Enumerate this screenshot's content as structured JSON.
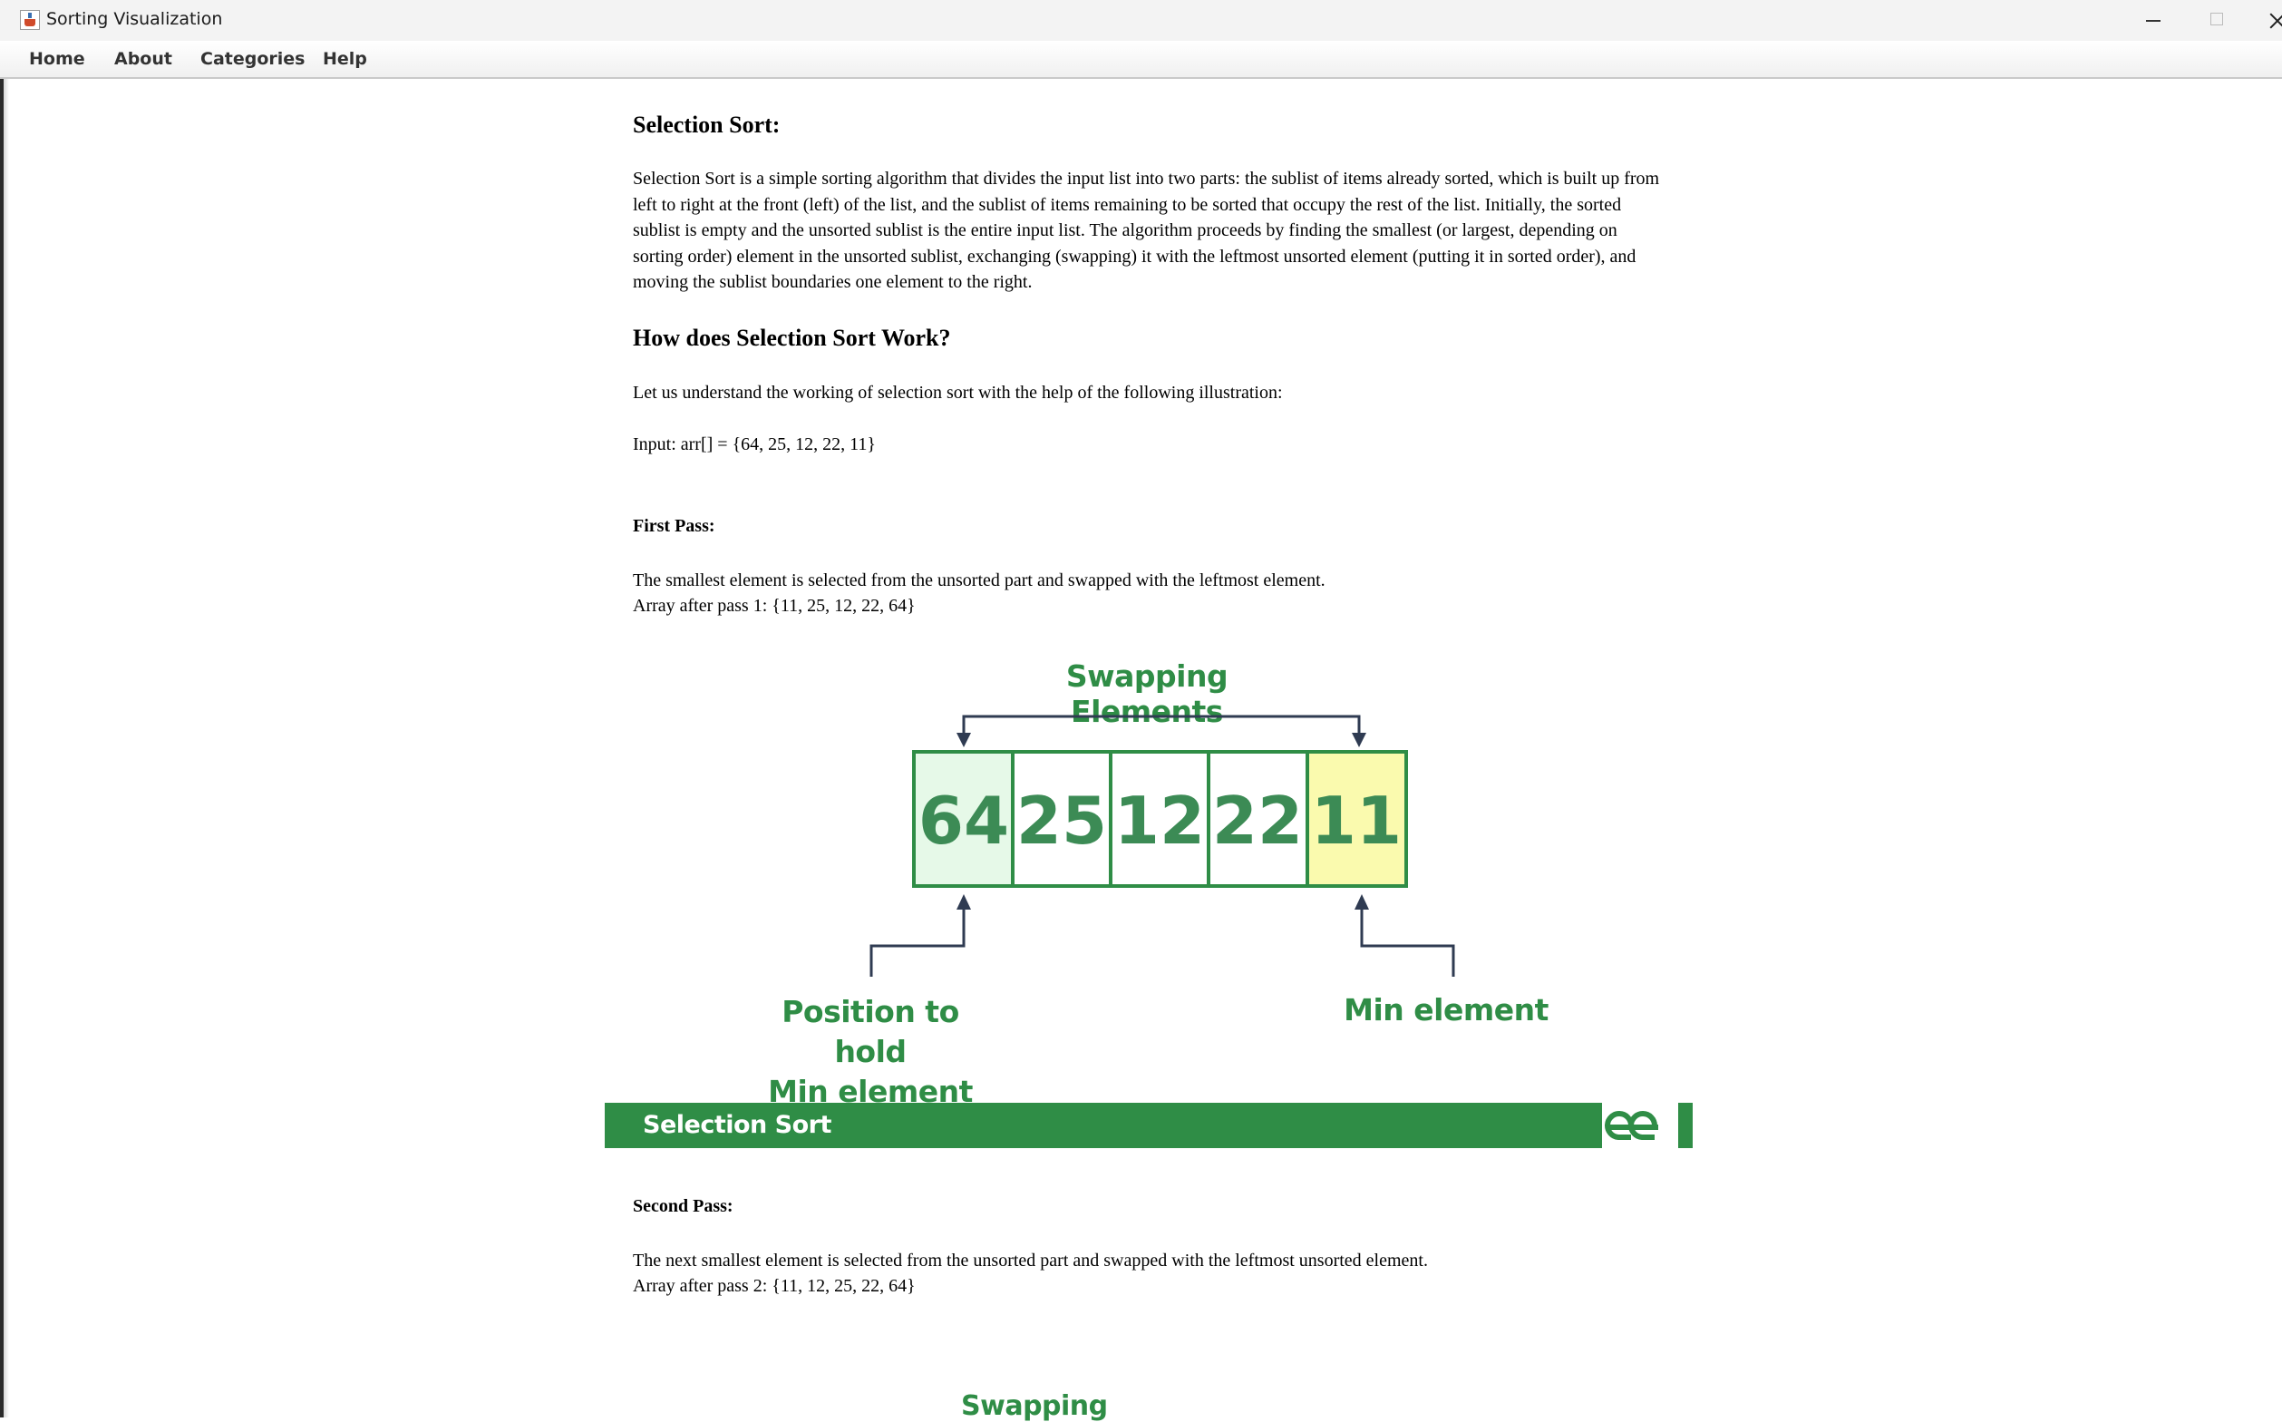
{
  "window": {
    "title": "Sorting Visualization"
  },
  "menu": [
    {
      "label": "Home"
    },
    {
      "label": "About"
    },
    {
      "label": "Categories"
    },
    {
      "label": "Help"
    }
  ],
  "article": {
    "heading": "Selection Sort:",
    "intro": "Selection Sort is a simple sorting algorithm that divides the input list into two parts: the sublist of items already sorted, which is built up from left to right at the front (left) of the list, and the sublist of items remaining to be sorted that occupy the rest of the list. Initially, the sorted sublist is empty and the unsorted sublist is the entire input list. The algorithm proceeds by finding the smallest (or largest, depending on sorting order) element in the unsorted sublist, exchanging (swapping) it with the leftmost unsorted element (putting it in sorted order), and moving the sublist boundaries one element to the right.",
    "how_heading": "How does Selection Sort Work?",
    "how_intro": "Let us understand the working of selection sort with the help of the following illustration:",
    "input": "Input: arr[] = {64, 25, 12, 22, 11}",
    "first_pass": {
      "heading": "First Pass:",
      "text": "The smallest element is selected from the unsorted part and swapped with the leftmost element.",
      "result": "Array after pass 1: {11, 25, 12, 22, 64}"
    },
    "second_pass": {
      "heading": "Second Pass:",
      "text": "The next smallest element is selected from the unsorted part and swapped with the leftmost unsorted element.",
      "result": "Array after pass 2: {11, 12, 25, 22, 64}"
    }
  },
  "illustration": {
    "title": "Swapping Elements",
    "cells": [
      "64",
      "25",
      "12",
      "22",
      "11"
    ],
    "left_label_line1": "Position to hold",
    "left_label_line2": "Min element",
    "right_label": "Min element",
    "banner": "Selection Sort",
    "colors": {
      "green": "#2f8d46",
      "cell_text": "#3c8b55",
      "position_fill": "#e6f9e8",
      "min_fill": "#fafaae",
      "arrow": "#2f3b52"
    }
  },
  "next_illustration": {
    "title_partial": "Swapping"
  }
}
